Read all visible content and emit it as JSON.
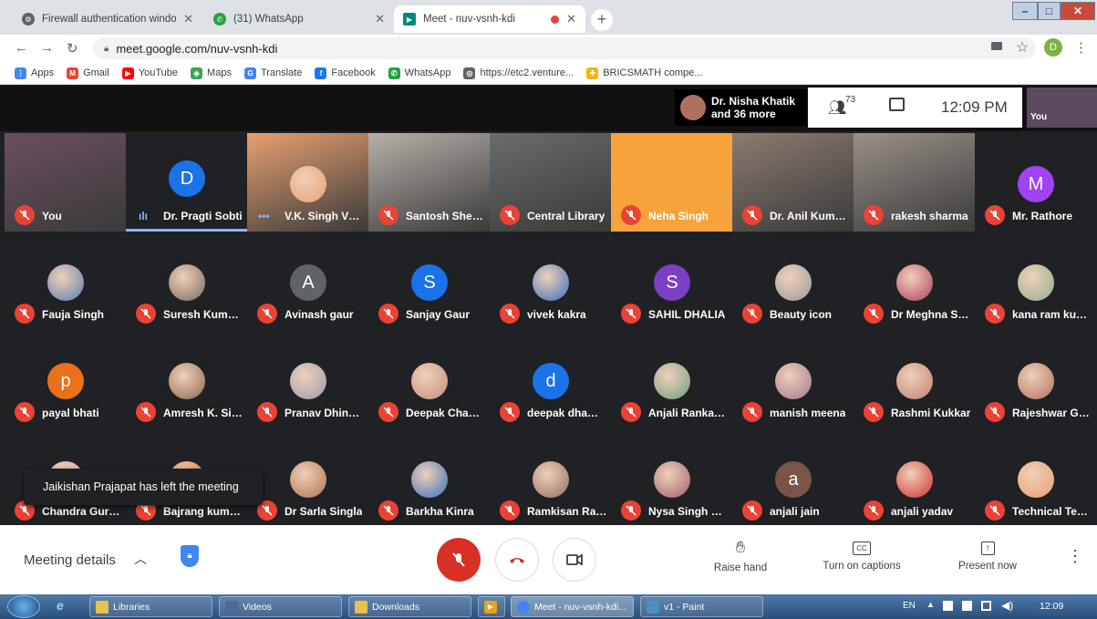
{
  "tabs": [
    {
      "title": "Firewall authentication window h",
      "icon": "chrome-settings-icon"
    },
    {
      "title": "(31) WhatsApp",
      "icon": "whatsapp-icon"
    },
    {
      "title": "Meet - nuv-vsnh-kdi",
      "icon": "meet-icon",
      "active": true
    }
  ],
  "address": {
    "url": "meet.google.com/nuv-vsnh-kdi",
    "profile": "D"
  },
  "bookmarks": [
    {
      "label": "Apps",
      "color": "#4285f4",
      "glyph": "⋮"
    },
    {
      "label": "Gmail",
      "color": "#ea4335",
      "glyph": "M"
    },
    {
      "label": "YouTube",
      "color": "#ff0000",
      "glyph": "▶"
    },
    {
      "label": "Maps",
      "color": "#34a853",
      "glyph": "◆"
    },
    {
      "label": "Translate",
      "color": "#4285f4",
      "glyph": "G"
    },
    {
      "label": "Facebook",
      "color": "#1877f2",
      "glyph": "f"
    },
    {
      "label": "WhatsApp",
      "color": "#25a244",
      "glyph": "✆"
    },
    {
      "label": "https://etc2.venture...",
      "color": "#5f6368",
      "glyph": "◎"
    },
    {
      "label": "BRICSMATH compe...",
      "color": "#f4b400",
      "glyph": "✚"
    }
  ],
  "meet": {
    "presenter_name": "Dr. Nisha Khatik",
    "presenter_more": "and 36 more",
    "people_count": "73",
    "time": "12:09 PM",
    "self_label": "You"
  },
  "participants": [
    {
      "name": "You",
      "style": "photo",
      "color": "#6b4e60",
      "muted": true
    },
    {
      "name": "Dr. Pragti Sobti",
      "style": "letter",
      "letter": "D",
      "color": "#1a73e8",
      "speaking": true
    },
    {
      "name": "V.K. Singh VC ...",
      "style": "photo",
      "color": "#e8a070",
      "dots": true
    },
    {
      "name": "Santosh Shek...",
      "style": "photo",
      "color": "#b8b0a8",
      "muted": true
    },
    {
      "name": "Central Library",
      "style": "photo",
      "color": "#6b6b6b",
      "muted": true
    },
    {
      "name": "Neha Singh",
      "style": "solid",
      "color": "#f5a33a",
      "muted": true
    },
    {
      "name": "Dr. Anil Kumar...",
      "style": "photo",
      "color": "#8c7b70",
      "muted": true
    },
    {
      "name": "rakesh sharma",
      "style": "photo",
      "color": "#9a9088",
      "muted": true
    },
    {
      "name": "Mr. Rathore",
      "style": "letter",
      "letter": "M",
      "color": "#a142f4",
      "muted": true
    },
    {
      "name": "Fauja Singh",
      "style": "photo",
      "color": "#5a7fb0",
      "muted": true
    },
    {
      "name": "Suresh Kumar ...",
      "style": "photo",
      "color": "#7a6a60",
      "muted": true
    },
    {
      "name": "Avinash gaur",
      "style": "letter",
      "letter": "A",
      "color": "#5f6368",
      "muted": true
    },
    {
      "name": "Sanjay Gaur",
      "style": "letter",
      "letter": "S",
      "color": "#1a73e8",
      "muted": true
    },
    {
      "name": "vivek kakra",
      "style": "photo",
      "color": "#3a70c0",
      "muted": true
    },
    {
      "name": "SAHIL DHALIA",
      "style": "letter",
      "letter": "S",
      "color": "#7b3fc4",
      "muted": true
    },
    {
      "name": "Beauty icon",
      "style": "photo",
      "color": "#9a9a9a",
      "muted": true
    },
    {
      "name": "Dr Meghna Sh...",
      "style": "photo",
      "color": "#b04060",
      "muted": true
    },
    {
      "name": "kana ram kum...",
      "style": "photo",
      "color": "#8fb090",
      "muted": true
    },
    {
      "name": "payal bhati",
      "style": "letter",
      "letter": "p",
      "color": "#e8711a",
      "muted": true
    },
    {
      "name": "Amresh K. Sin...",
      "style": "photo",
      "color": "#8a6a50",
      "muted": true
    },
    {
      "name": "Pranav Dhingra",
      "style": "photo",
      "color": "#9a9ab0",
      "muted": true
    },
    {
      "name": "Deepak Chandel",
      "style": "photo",
      "color": "#c09080",
      "muted": true
    },
    {
      "name": "deepak dhamija",
      "style": "letter",
      "letter": "d",
      "color": "#1a73e8",
      "muted": true
    },
    {
      "name": "Anjali Rankawat",
      "style": "photo",
      "color": "#70a080",
      "muted": true
    },
    {
      "name": "manish meena",
      "style": "photo",
      "color": "#a07890",
      "muted": true
    },
    {
      "name": "Rashmi Kukkar",
      "style": "photo",
      "color": "#c08070",
      "muted": true
    },
    {
      "name": "Rajeshwar Go...",
      "style": "photo",
      "color": "#b07060",
      "muted": true
    },
    {
      "name": "Chandra Gurn...",
      "style": "photo",
      "color": "#e8a0b0",
      "muted": true
    },
    {
      "name": "Bajrang kumar...",
      "style": "photo",
      "color": "#e8711a",
      "muted": true
    },
    {
      "name": "Dr Sarla Singla",
      "style": "photo",
      "color": "#b07050",
      "muted": true
    },
    {
      "name": "Barkha Kinra",
      "style": "photo",
      "color": "#3a70c0",
      "muted": true
    },
    {
      "name": "Ramkisan Ran...",
      "style": "photo",
      "color": "#907060",
      "muted": true
    },
    {
      "name": "Nysa Singh Pu...",
      "style": "photo",
      "color": "#a06070",
      "muted": true
    },
    {
      "name": "anjali jain",
      "style": "letter",
      "letter": "a",
      "color": "#795548",
      "muted": true
    },
    {
      "name": "anjali yadav",
      "style": "photo",
      "color": "#d03030",
      "muted": true
    },
    {
      "name": "Technical Team",
      "style": "photo",
      "color": "#e8a070",
      "muted": true
    }
  ],
  "toast": "Jaikishan Prajapat has left the meeting",
  "controls": {
    "meeting_details": "Meeting details",
    "raise_hand": "Raise hand",
    "captions": "Turn on captions",
    "present": "Present now"
  },
  "taskbar": {
    "items": [
      {
        "label": "Libraries",
        "color": "#e8c050"
      },
      {
        "label": "Videos",
        "color": "#4a6a9a"
      },
      {
        "label": "Downloads",
        "color": "#e8c050"
      },
      {
        "label": "",
        "color": "#e8a020"
      },
      {
        "label": "Meet - nuv-vsnh-kdi...",
        "color": "#4285f4"
      },
      {
        "label": "v1 - Paint",
        "color": "#4a90c0"
      }
    ],
    "lang": "EN",
    "clock": "12:09"
  }
}
